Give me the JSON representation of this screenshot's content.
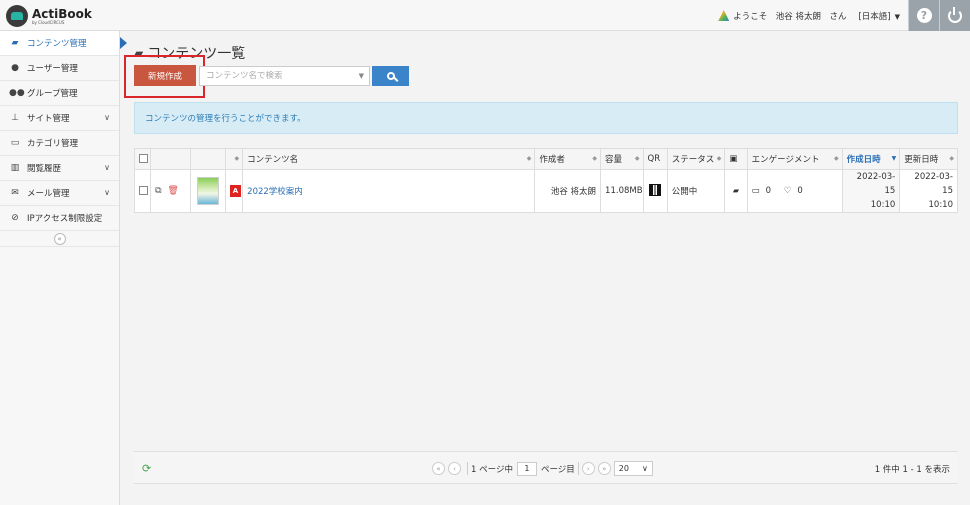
{
  "app": {
    "name": "ActiBook",
    "sub": "by CloudCIRCUS"
  },
  "header": {
    "welcome": "ようこそ　池谷 将太朗　さん",
    "language": "[日本語]",
    "help_icon": "question-icon",
    "logout_icon": "power-icon"
  },
  "sidebar": {
    "items": [
      {
        "label": "コンテンツ管理",
        "icon": "book-icon",
        "active": true
      },
      {
        "label": "ユーザー管理",
        "icon": "user-icon"
      },
      {
        "label": "グループ管理",
        "icon": "users-icon"
      },
      {
        "label": "サイト管理",
        "icon": "sitemap-icon",
        "expand": true
      },
      {
        "label": "カテゴリ管理",
        "icon": "folder-icon"
      },
      {
        "label": "閲覧履歴",
        "icon": "bar-chart-icon",
        "expand": true
      },
      {
        "label": "メール管理",
        "icon": "envelope-icon",
        "expand": true
      },
      {
        "label": "IPアクセス制限設定",
        "icon": "ban-icon"
      }
    ],
    "collapse_label": "«"
  },
  "main": {
    "title": "コンテンツ一覧",
    "new_button": "新規作成",
    "search_placeholder": "コンテンツ名で検索",
    "info": "コンテンツの管理を行うことができます。",
    "table": {
      "headers": {
        "name": "コンテンツ名",
        "author": "作成者",
        "size": "容量",
        "qr": "QR",
        "status": "ステータス",
        "engagement": "エンゲージメント",
        "created": "作成日時",
        "updated": "更新日時"
      },
      "rows": [
        {
          "name": "2022学校案内",
          "author": "池谷 将太朗",
          "size": "11.08MB",
          "status": "公開中",
          "comments": "0",
          "likes": "0",
          "created_date": "2022-03-15",
          "created_time": "10:10",
          "updated_date": "2022-03-15",
          "updated_time": "10:10"
        }
      ]
    },
    "pager": {
      "page_prefix": "1 ページ中",
      "page_value": "1",
      "page_suffix": "ページ目",
      "per_page": "20",
      "count": "1 件中 1 - 1 を表示"
    }
  },
  "colors": {
    "accent": "#2a6fb5",
    "new_button": "#c9573f",
    "search_button": "#3b84c9",
    "highlight": "#d8262c"
  }
}
